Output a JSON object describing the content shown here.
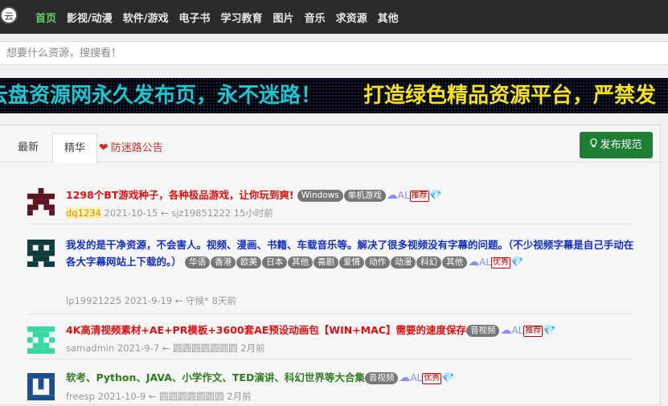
{
  "nav": {
    "logo_text": "云",
    "items": [
      "首页",
      "影视/动漫",
      "软件/游戏",
      "电子书",
      "学习教育",
      "图片",
      "音乐",
      "求资源",
      "其他"
    ],
    "active_index": 0
  },
  "search": {
    "placeholder": "想要什么资源，搜搜看！"
  },
  "ticker": {
    "text1": "云盘资源网永久发布页，永不迷路！",
    "text2": "打造绿色精品资源平台，严禁发",
    "color1": "#19c6d2",
    "color2": "#f5e21b"
  },
  "tabs": {
    "latest": "最新",
    "essence": "精华",
    "notice": "防迷路公告",
    "notice_icon": "heart-icon"
  },
  "publish_button": {
    "label": "发布规范",
    "icon": "lightbulb-icon",
    "color": "#1e7e34"
  },
  "threads": [
    {
      "title": "1298个BT游戏种子，各种极品游戏，让你玩到爽!",
      "title_color": "#e01010",
      "tags": [
        "Windows",
        "单机游戏"
      ],
      "al": "AL",
      "badge": "推荐",
      "gem_color": "#5bc8e8",
      "author": "dq1234",
      "date": "2021-10-15",
      "arrow": "←",
      "last_reply_user": "sjz19851222",
      "last_reply_time": "15小时前",
      "avatar_color": "#5b1620"
    },
    {
      "title": "我发的是干净资源，不会害人。视频、漫画、书籍、车载音乐等。解决了很多视频没有字幕的问题。（不少视频字幕是自己手动在各大字幕网站上下载的。）",
      "title_color": "#1530c8",
      "tags": [
        "华语",
        "香港",
        "欧美",
        "日本",
        "其他",
        "喜剧",
        "爱情",
        "动作",
        "动漫",
        "科幻",
        "其他"
      ],
      "al": "AL",
      "badge": "优秀",
      "gem_color": "#5bc8e8",
      "author": "lp19921225",
      "date": "2021-9-19",
      "arrow": "←",
      "last_reply_user": "守候*",
      "last_reply_time": "8天前",
      "avatar_color": "#0e3b3b"
    },
    {
      "title": "4K高清视频素材+AE+PR模板+3600套AE预设动画包【WIN+MAC】需要的速度保存",
      "title_color": "#e01010",
      "tags": [
        "音视频"
      ],
      "al": "AL",
      "badge": "推荐",
      "gem_color": "#e05060",
      "author": "samadmin",
      "date": "2021-9-7",
      "arrow": "←",
      "last_reply_user": "圆圆圆圆圆圆圆",
      "last_reply_time": "2月前",
      "avatar_color": "#38d9a0"
    },
    {
      "title": "软考、Python、JAVA、小学作文、TED演讲、科幻世界等大合集",
      "title_color": "#2e7d1e",
      "tags": [
        "音视频"
      ],
      "al": "AL",
      "badge": "优秀",
      "gem_color": "#5bc8e8",
      "author": "freesp",
      "date": "2021-10-9",
      "arrow": "←",
      "last_reply_user": "圆圆圆圆圆圆圆",
      "last_reply_time": "2月前",
      "avatar_color": "#1b4f8a"
    }
  ]
}
